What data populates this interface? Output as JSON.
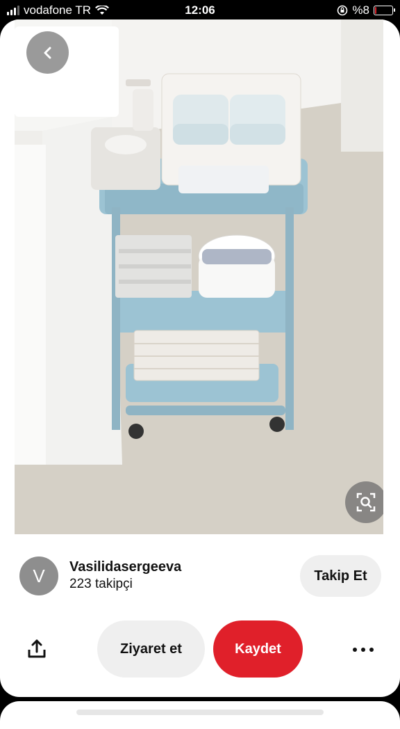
{
  "status_bar": {
    "carrier": "vodafone TR",
    "time": "12:06",
    "battery_percent": "%8",
    "battery_level": 0.08
  },
  "pin": {
    "image_alt": "Blue three-tier rolling cart with diapers, wipes and towels",
    "back_icon": "chevron-left-icon",
    "visual_search_icon": "visual-search-icon"
  },
  "author": {
    "avatar_initial": "V",
    "name": "Vasilidasergeeva",
    "followers": "223 takipçi",
    "follow_label": "Takip Et"
  },
  "actions": {
    "share_icon": "share-icon",
    "visit_label": "Ziyaret et",
    "save_label": "Kaydet",
    "more_icon": "more-icon"
  },
  "colors": {
    "save_red": "#e0202a",
    "button_gray": "#efefef",
    "cart_blue": "#9cc3d3"
  }
}
